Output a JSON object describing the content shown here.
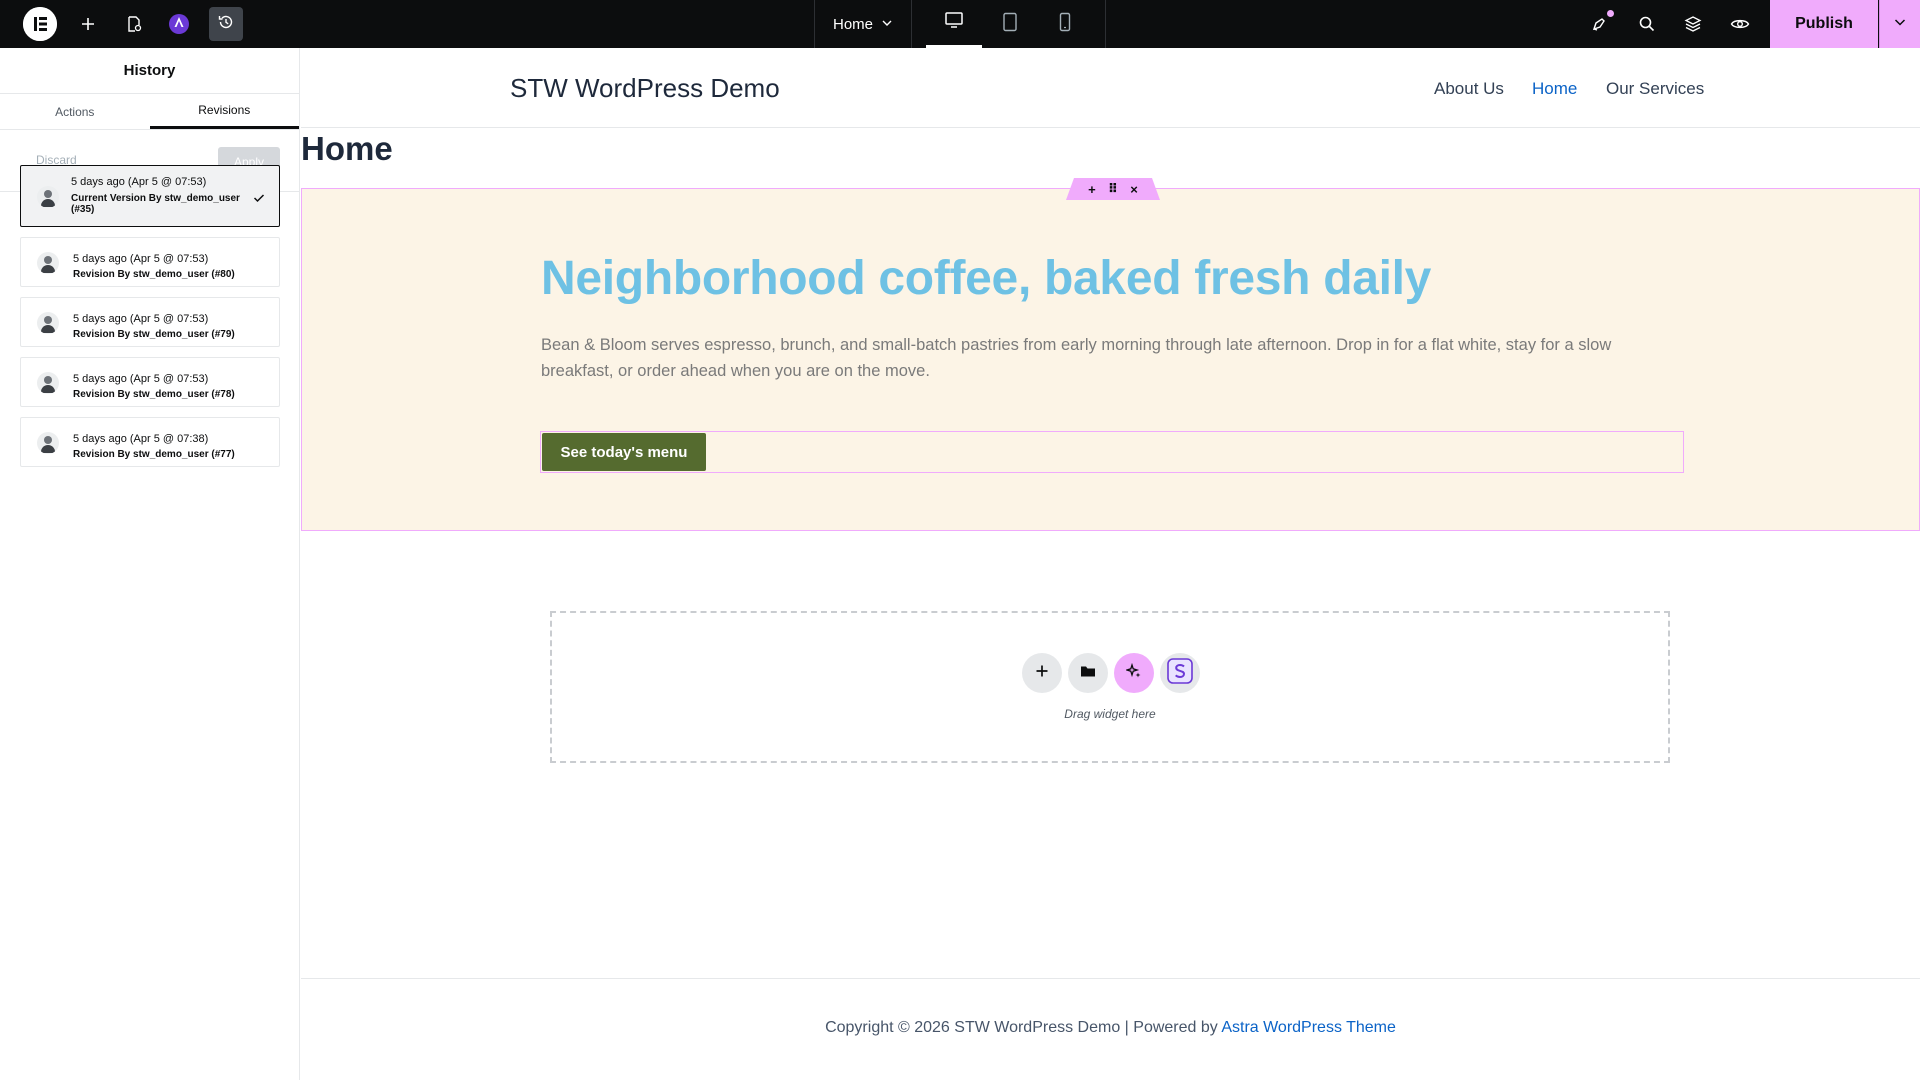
{
  "topbar": {
    "page_name": "Home",
    "publish_label": "Publish",
    "icons": [
      "elementor-logo-icon",
      "plus-icon",
      "page-settings-icon",
      "ai-angie-icon",
      "history-icon",
      "chevron-down-icon",
      "desktop-icon",
      "tablet-icon",
      "mobile-icon",
      "notifications-icon",
      "search-icon",
      "layers-icon",
      "eye-icon"
    ]
  },
  "panel": {
    "title": "History",
    "tabs": [
      {
        "label": "Actions"
      },
      {
        "label": "Revisions"
      }
    ],
    "discard_label": "Discard",
    "apply_label": "Apply",
    "revisions": [
      {
        "date": "5 days ago (Apr 5 @ 07:53)",
        "author": "Current Version By stw_demo_user (#35)",
        "current": true
      },
      {
        "date": "5 days ago (Apr 5 @ 07:53)",
        "author": "Revision By stw_demo_user (#80)"
      },
      {
        "date": "5 days ago (Apr 5 @ 07:53)",
        "author": "Revision By stw_demo_user (#79)"
      },
      {
        "date": "5 days ago (Apr 5 @ 07:53)",
        "author": "Revision By stw_demo_user (#78)"
      },
      {
        "date": "5 days ago (Apr 5 @ 07:38)",
        "author": "Revision By stw_demo_user (#77)"
      }
    ]
  },
  "site": {
    "title": "STW WordPress Demo",
    "nav": [
      {
        "label": "About Us"
      },
      {
        "label": "Home"
      },
      {
        "label": "Our Services"
      }
    ],
    "page_title": "Home"
  },
  "hero": {
    "heading": "Neighborhood coffee, baked fresh daily",
    "text": "Bean & Bloom serves espresso, brunch, and small-batch pastries from early morning through late afternoon. Drop in for a flat white, stay for a slow breakfast, or order ahead when you are on the move.",
    "button_label": "See today's menu",
    "handle_glyphs": [
      "+",
      "⠿",
      "×"
    ]
  },
  "drop_zone": {
    "label": "Drag widget here"
  },
  "footer": {
    "prefix": "Copyright © 2026 STW WordPress Demo | Powered by ",
    "link": "Astra WordPress Theme"
  },
  "colors": {
    "topbar_bg": "#0c0d0e",
    "accent": "#f0abfc",
    "hero_bg": "#fcf4e6",
    "hero_heading": "#6ec1e4",
    "hero_button": "#556b2f",
    "nav_active": "#0b63c7",
    "ai_purple": "#6b39d6"
  }
}
